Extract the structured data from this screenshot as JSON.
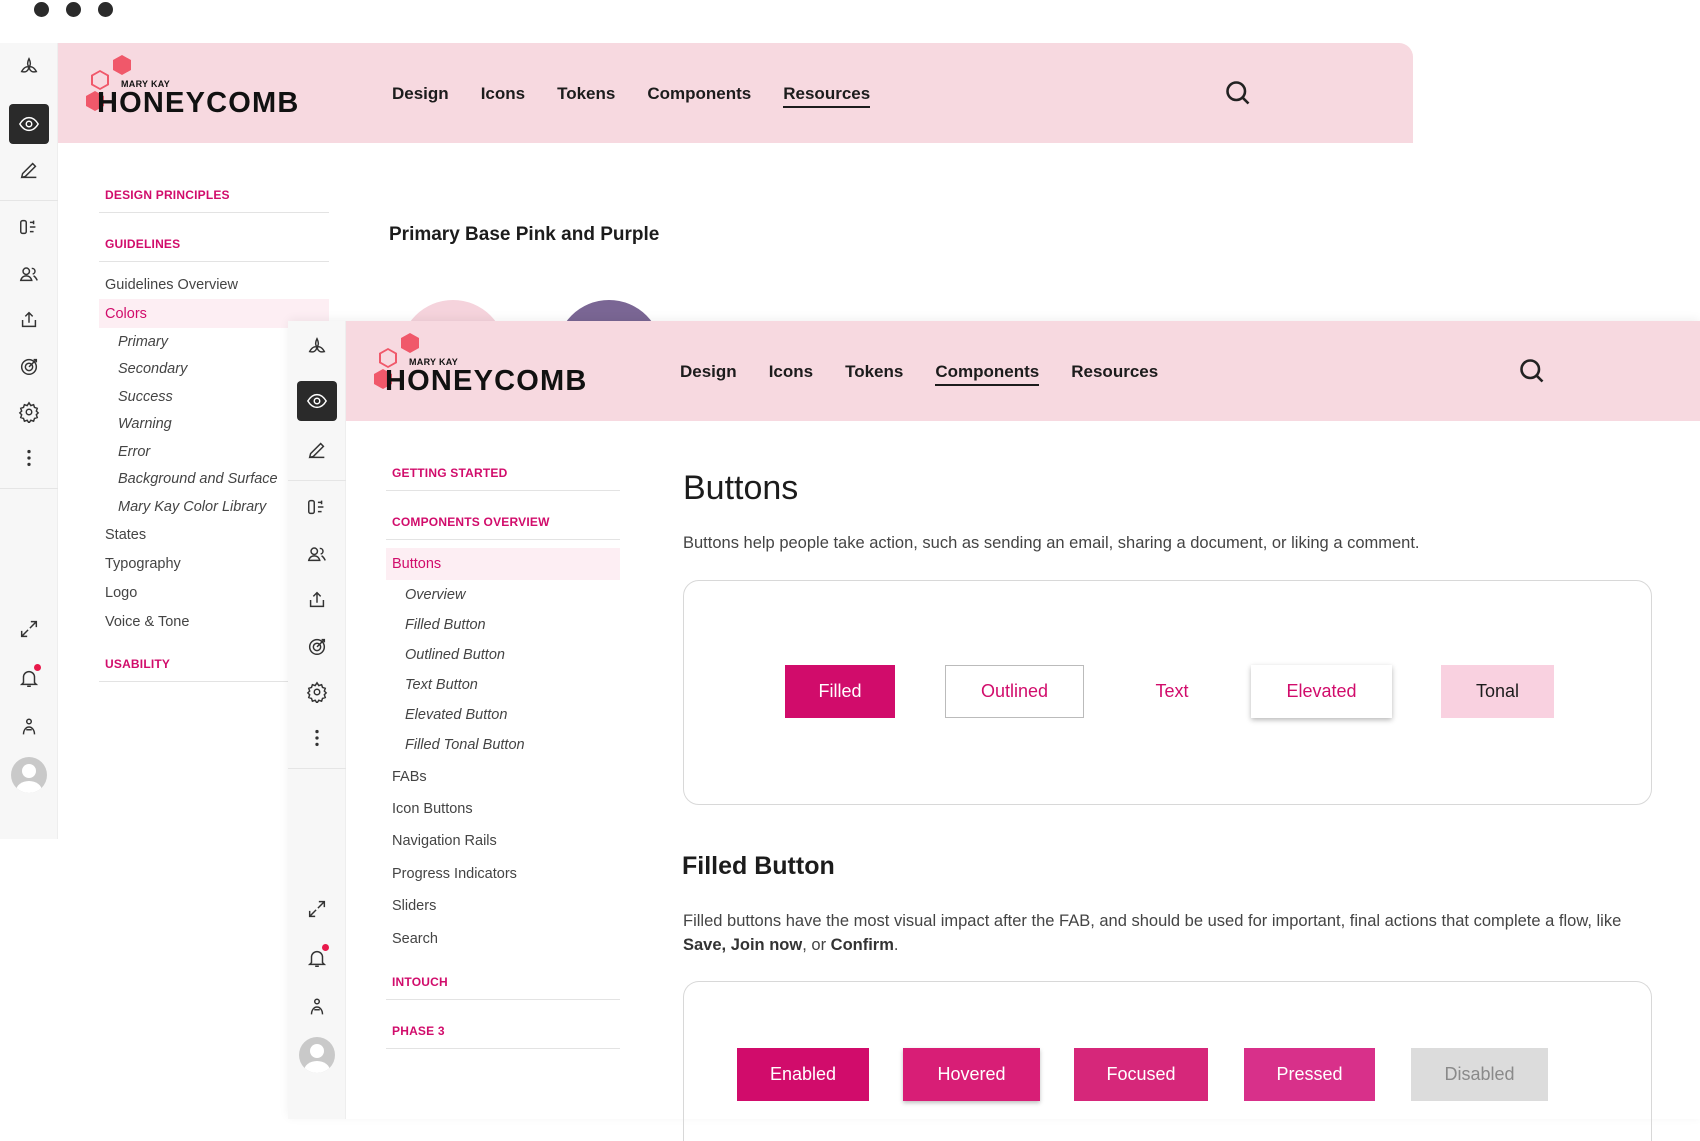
{
  "back_window": {
    "brand": {
      "small": "MARY KAY",
      "big": "HONEYCOMB"
    },
    "nav": [
      "Design",
      "Icons",
      "Tokens",
      "Components",
      "Resources"
    ],
    "nav_current": "Resources",
    "sidebar": {
      "design_principles": "DESIGN PRINCIPLES",
      "guidelines": "GUIDELINES",
      "items": [
        "Guidelines Overview",
        "Colors"
      ],
      "color_subitems": [
        "Primary",
        "Secondary",
        "Success",
        "Warning",
        "Error",
        "Background and Surface",
        "Mary Kay Color Library"
      ],
      "items_after": [
        "States",
        "Typography",
        "Logo",
        "Voice & Tone"
      ],
      "usability": "USABILITY"
    },
    "content_title": "Primary  Base Pink and Purple",
    "swatches": [
      "#f5d3dc",
      "#7a6694"
    ]
  },
  "front_window": {
    "brand": {
      "small": "MARY KAY",
      "big": "HONEYCOMB"
    },
    "nav": [
      "Design",
      "Icons",
      "Tokens",
      "Components",
      "Resources"
    ],
    "nav_current": "Components",
    "sidebar": {
      "getting_started": "GETTING STARTED",
      "components_overview": "COMPONENTS OVERVIEW",
      "active_item": "Buttons",
      "button_subitems": [
        "Overview",
        "Filled Button",
        "Outlined Button",
        "Text Button",
        "Elevated Button",
        "Filled Tonal Button"
      ],
      "items_after": [
        "FABs",
        "Icon Buttons",
        "Navigation Rails",
        "Progress Indicators",
        "Sliders",
        "Search"
      ],
      "intouch": "INTOUCH",
      "phase3": "PHASE 3"
    },
    "title": "Buttons",
    "description": "Buttons help people take action, such as sending an email, sharing a document, or liking a comment.",
    "button_types": {
      "filled": "Filled",
      "outlined": "Outlined",
      "text": "Text",
      "elevated": "Elevated",
      "tonal": "Tonal"
    },
    "filled_section": {
      "title": "Filled Button",
      "desc_prefix": "Filled buttons have the most visual impact after the FAB, and should be used for important, final actions that complete a flow, like ",
      "save": "Save,",
      "join": "Join now",
      "or": ", or ",
      "confirm": "Confirm",
      "period": "."
    },
    "states": {
      "enabled": "Enabled",
      "hovered": "Hovered",
      "focused": "Focused",
      "pressed": "Pressed",
      "disabled": "Disabled"
    }
  },
  "colors": {
    "accent": "#d10c6b",
    "header_bg": "#f7d9e0",
    "logo_hex": "#f0586a"
  }
}
